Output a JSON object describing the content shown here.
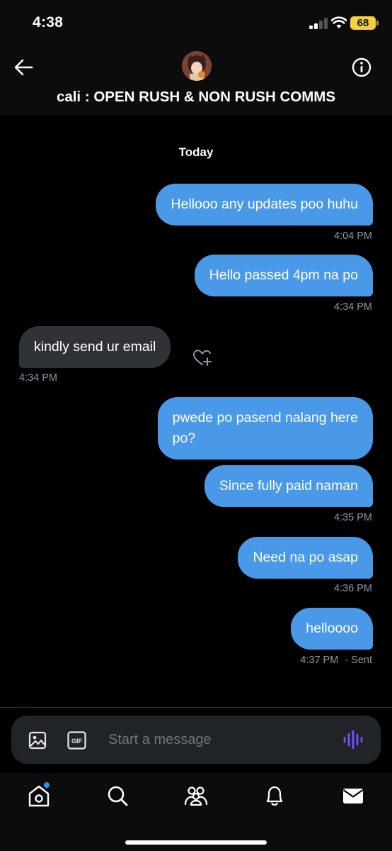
{
  "status_bar": {
    "time": "4:38",
    "battery": "68"
  },
  "header": {
    "title": "cali : OPEN RUSH & NON RUSH COMMS"
  },
  "day_label": "Today",
  "messages": [
    {
      "text": "Hellooo any updates poo huhu",
      "time": "4:04 PM"
    },
    {
      "text": "Hello passed 4pm na po",
      "time": "4:34 PM"
    },
    {
      "text": "kindly send ur email",
      "time": "4:34 PM"
    },
    {
      "text_line1": "pwede po pasend nalang here",
      "text_line2": "po?"
    },
    {
      "text": "Since fully paid naman",
      "time": "4:35 PM"
    },
    {
      "text": "Need na po asap",
      "time": "4:36 PM"
    },
    {
      "text": "helloooo",
      "time": "4:37 PM",
      "status": "· Sent"
    }
  ],
  "composer": {
    "placeholder": "Start a message"
  },
  "colors": {
    "outgoing_bubble": "#4a99e9",
    "incoming_bubble": "#2f3336",
    "accent": "#1d9bf0",
    "voice": "#7856ff"
  }
}
